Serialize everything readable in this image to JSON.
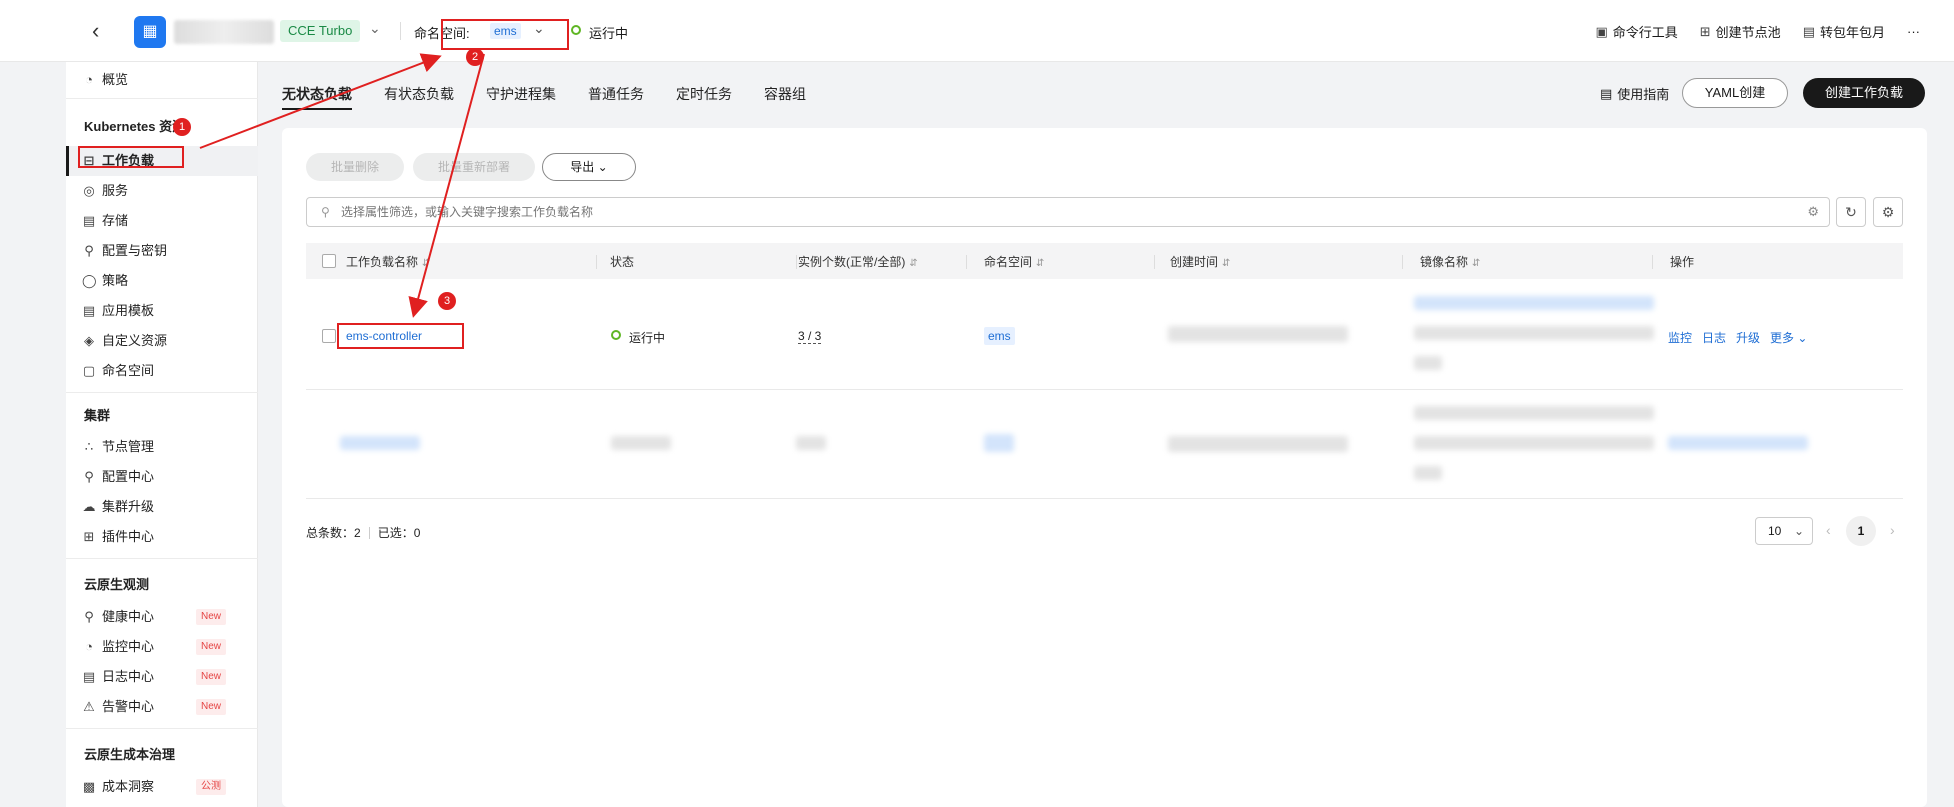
{
  "topbar": {
    "back_icon": "chevron-left",
    "cluster_tag": "CCE Turbo",
    "namespace_label": "命名空间:",
    "namespace_value": "ems",
    "status": "运行中",
    "tools": [
      "命令行工具",
      "创建节点池",
      "转包年包月"
    ],
    "more": "···"
  },
  "sidebar": {
    "overview": "概览",
    "k8s_section": "Kubernetes 资源",
    "k8s_items": [
      "工作负载",
      "服务",
      "存储",
      "配置与密钥",
      "策略",
      "应用模板",
      "自定义资源",
      "命名空间"
    ],
    "cluster_section": "集群",
    "cluster_items": [
      "节点管理",
      "配置中心",
      "集群升级",
      "插件中心"
    ],
    "observe_section": "云原生观测",
    "observe_items": [
      "健康中心",
      "监控中心",
      "日志中心",
      "告警中心"
    ],
    "new_badge": "New",
    "cost_section": "云原生成本治理",
    "cost_items": [
      "成本洞察"
    ],
    "beta_badge": "公测"
  },
  "tabs": [
    "无状态负载",
    "有状态负载",
    "守护进程集",
    "普通任务",
    "定时任务",
    "容器组"
  ],
  "actions": {
    "guide": "使用指南",
    "yaml_create": "YAML创建",
    "create_workload": "创建工作负载",
    "batch_delete": "批量删除",
    "batch_redeploy": "批量重新部署",
    "export": "导出"
  },
  "search": {
    "placeholder": "选择属性筛选，或输入关键字搜索工作负载名称"
  },
  "table": {
    "headers": [
      "工作负载名称",
      "状态",
      "实例个数(正常/全部)",
      "命名空间",
      "创建时间",
      "镜像名称",
      "操作"
    ],
    "rows": [
      {
        "name": "ems-controller",
        "status": "运行中",
        "instances": "3 / 3",
        "namespace": "ems"
      }
    ],
    "ops": [
      "监控",
      "日志",
      "升级",
      "更多"
    ]
  },
  "footer": {
    "total_label": "总条数：",
    "total": "2",
    "selected_label": "已选：",
    "selected": "0",
    "page_size": "10",
    "current_page": "1"
  },
  "annotations": [
    "1",
    "2",
    "3"
  ],
  "colors": {
    "accent": "#1f6ed4",
    "annotation": "#e02020",
    "running": "#5fb624",
    "primary_button": "#191919"
  }
}
